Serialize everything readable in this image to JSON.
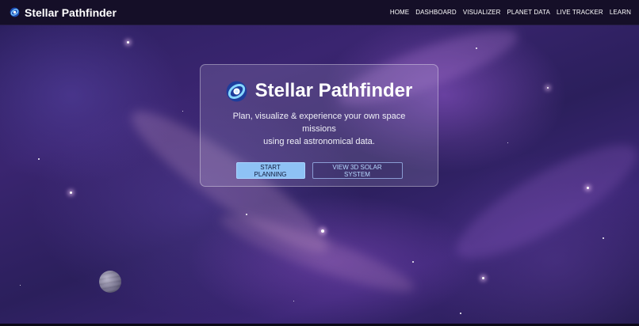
{
  "brand": {
    "name": "Stellar Pathfinder",
    "logo_icon": "galaxy-icon"
  },
  "nav": {
    "links": [
      "HOME",
      "DASHBOARD",
      "VISUALIZER",
      "PLANET DATA",
      "LIVE TRACKER",
      "LEARN"
    ]
  },
  "hero": {
    "title": "Stellar Pathfinder",
    "subtitle_line1": "Plan, visualize & experience your own space missions",
    "subtitle_line2": "using real astronomical data.",
    "primary_button": "START PLANNING",
    "secondary_button": "VIEW 3D SOLAR SYSTEM"
  },
  "colors": {
    "navbar": "#150f28",
    "primary_button": "#8ec2f5",
    "secondary_border": "#aac8ff",
    "background": "#2a1f5e"
  }
}
